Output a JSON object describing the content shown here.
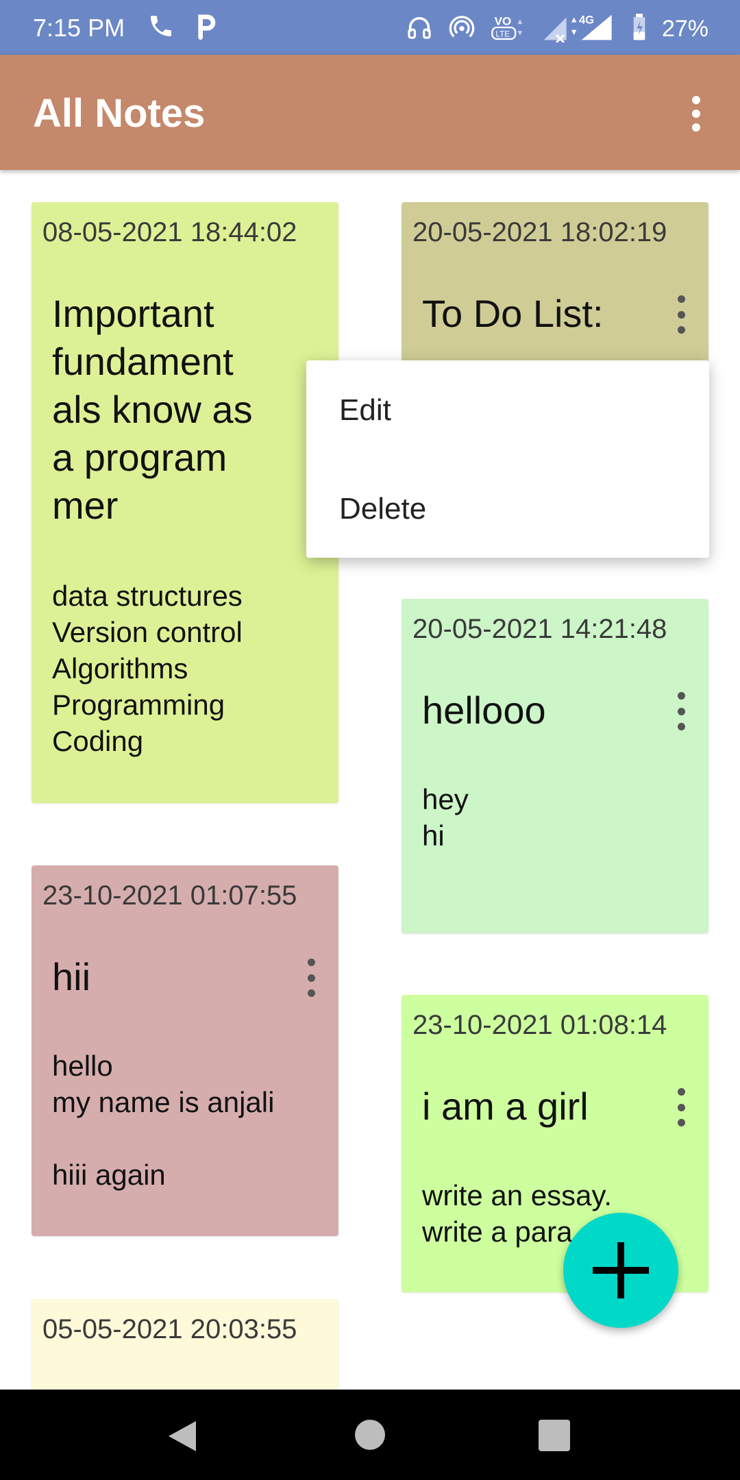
{
  "status_bar": {
    "time": "7:15 PM",
    "network": "4G",
    "battery": "27%",
    "icons": [
      "phone-icon",
      "p-icon",
      "headset-icon",
      "hotspot-icon",
      "volte-icon",
      "signal-icon",
      "battery-icon"
    ]
  },
  "app_bar": {
    "title": "All Notes",
    "menu_icon": "more-vertical-icon"
  },
  "notes": [
    {
      "date": "08-05-2021 18:44:02",
      "title": "Important\nfundament\nals know as\na program\nmer",
      "body": "data structures\nVersion control\nAlgorithms\nProgramming\nCoding",
      "color": "#dcf195"
    },
    {
      "date": "20-05-2021 18:02:19",
      "title": "To Do List:",
      "body": "",
      "color": "#cfcc96"
    },
    {
      "date": "20-05-2021 14:21:48",
      "title": "hellooo",
      "body": "hey\nhi",
      "color": "#ccf5c8"
    },
    {
      "date": "23-10-2021 01:07:55",
      "title": "hii",
      "body": "hello\nmy name is anjali\n\nhiii again",
      "color": "#d6adad"
    },
    {
      "date": "23-10-2021 01:08:14",
      "title": "i am a girl",
      "body": "write an essay.\nwrite a para",
      "color": "#cdff9f"
    },
    {
      "date": "05-05-2021 20:03:55",
      "title": "",
      "body": "",
      "color": "#fef9d9"
    }
  ],
  "popup_menu": {
    "edit": "Edit",
    "delete": "Delete"
  },
  "fab": {
    "icon": "plus-icon",
    "color": "#00d8c8"
  },
  "nav": {
    "back": "back-icon",
    "home": "home-icon",
    "recent": "recents-icon"
  }
}
